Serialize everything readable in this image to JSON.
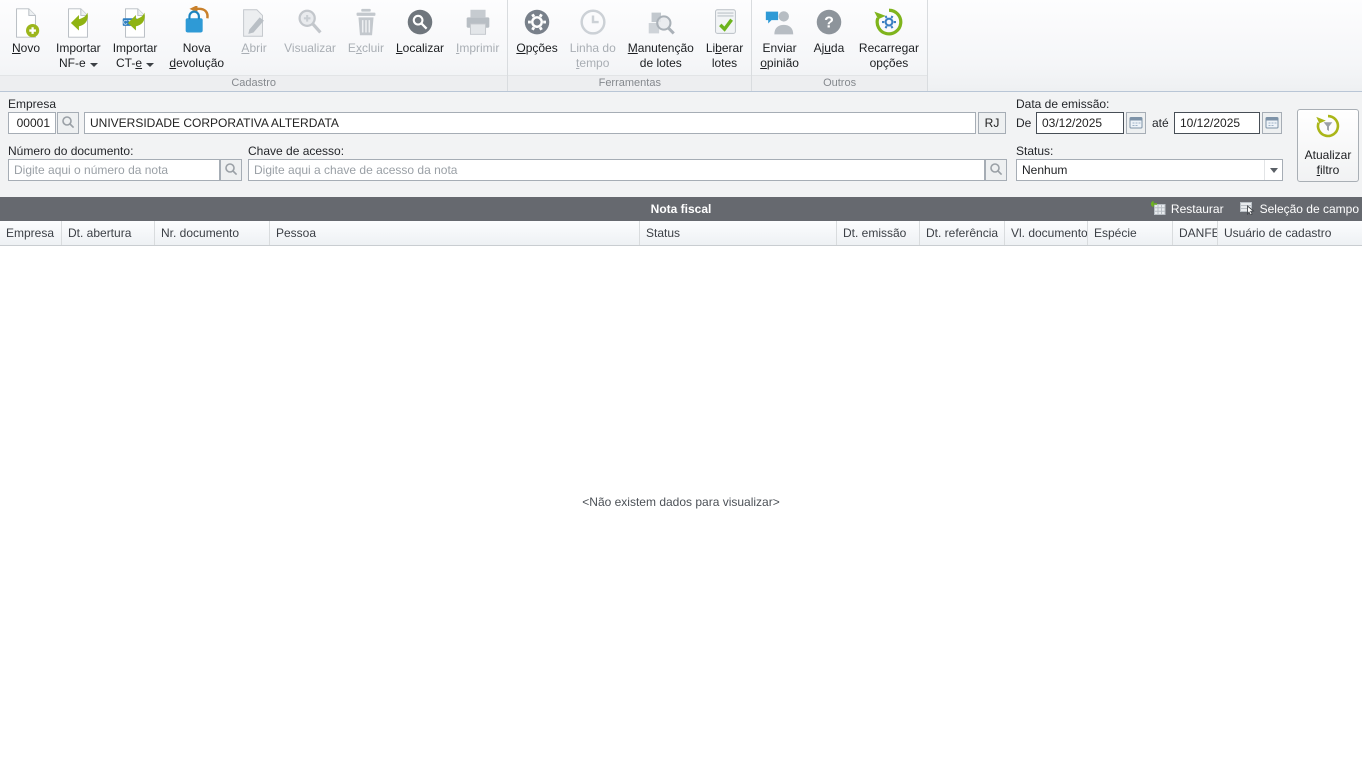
{
  "colors": {
    "accent_green": "#8fb312",
    "bag_blue": "#2e9ad6",
    "grid_titlebar_gray": "#66696f",
    "check_green": "#6cb41e",
    "gear_blue": "#3a7fc1",
    "filter_ring_olive": "#aab618"
  },
  "toolbar": {
    "groups": [
      {
        "label": "Cadastro",
        "buttons": [
          {
            "line1": "Novo",
            "line2": ""
          },
          {
            "line1": "Importar",
            "line2": "NF-e"
          },
          {
            "line1": "Importar",
            "line2": "CT-e"
          },
          {
            "line1": "Nova",
            "line2": "devolução"
          },
          {
            "line1": "Abrir",
            "line2": ""
          },
          {
            "line1": "Visualizar",
            "line2": ""
          },
          {
            "line1": "Excluir",
            "line2": ""
          },
          {
            "line1": "Localizar",
            "line2": ""
          },
          {
            "line1": "Imprimir",
            "line2": ""
          }
        ]
      },
      {
        "label": "Ferramentas",
        "buttons": [
          {
            "line1": "Opções",
            "line2": ""
          },
          {
            "line1": "Linha do",
            "line2": "tempo"
          },
          {
            "line1": "Manutenção",
            "line2": "de lotes"
          },
          {
            "line1": "Liberar",
            "line2": "lotes"
          }
        ]
      },
      {
        "label": "Outros",
        "buttons": [
          {
            "line1": "Enviar",
            "line2": "opinião"
          },
          {
            "line1": "Ajuda",
            "line2": ""
          },
          {
            "line1": "Recarregar",
            "line2": "opções"
          }
        ]
      }
    ]
  },
  "filters": {
    "empresa": {
      "label": "Empresa",
      "code": "00001",
      "name": "UNIVERSIDADE CORPORATIVA ALTERDATA",
      "uf": "RJ"
    },
    "data_emissao": {
      "label": "Data de emissão:",
      "de_label": "De",
      "de_value": "03/12/2025",
      "ate_label": "até",
      "ate_value": "10/12/2025"
    },
    "numero": {
      "label": "Número do documento:",
      "placeholder": "Digite aqui o número da nota"
    },
    "chave": {
      "label": "Chave de acesso:",
      "placeholder": "Digite aqui a chave de acesso da nota"
    },
    "status": {
      "label": "Status:",
      "value": "Nenhum"
    },
    "atualizar": {
      "line1": "Atualizar",
      "line2": "filtro"
    }
  },
  "grid": {
    "title": "Nota fiscal",
    "restaurar_label": "Restaurar",
    "selecao_label": "Seleção de campo",
    "columns": [
      "Empresa",
      "Dt. abertura",
      "Nr. documento",
      "Pessoa",
      "Status",
      "Dt. emissão",
      "Dt. referência",
      "Vl. documento",
      "Espécie",
      "DANFE",
      "Usuário de cadastro"
    ],
    "rows": [],
    "empty_message": "<Não existem dados para visualizar>"
  }
}
